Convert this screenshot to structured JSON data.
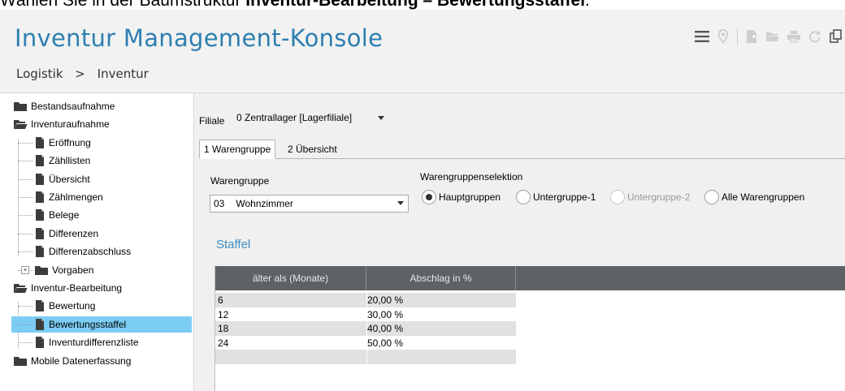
{
  "caption": {
    "prefix": "Wählen Sie in der Baumstruktur ",
    "bold": "Inventur-Bearbeitung – Bewertungsstaffel",
    "suffix": "."
  },
  "app": {
    "title": "Inventur Management-Konsole",
    "breadcrumb": {
      "first": "Logistik",
      "separator": ">",
      "second": "Inventur"
    }
  },
  "toolbar": {
    "icons": [
      "list-settings-icon",
      "pin-icon",
      "new-document-icon",
      "open-folder-icon",
      "print-icon",
      "refresh-icon",
      "copy-icon"
    ]
  },
  "sidebar": {
    "items": [
      {
        "label": "Bestandsaufnahme",
        "icon": "folder-closed-icon"
      },
      {
        "label": "Inventuraufnahme",
        "icon": "folder-open-icon"
      },
      {
        "label": "Eröffnung",
        "icon": "document-icon"
      },
      {
        "label": "Zähllisten",
        "icon": "document-icon"
      },
      {
        "label": "Übersicht",
        "icon": "document-icon"
      },
      {
        "label": "Zählmengen",
        "icon": "document-icon"
      },
      {
        "label": "Belege",
        "icon": "document-icon"
      },
      {
        "label": "Differenzen",
        "icon": "document-icon"
      },
      {
        "label": "Differenzabschluss",
        "icon": "document-icon"
      },
      {
        "label": "Vorgaben",
        "icon": "folder-closed-icon"
      },
      {
        "label": "Inventur-Bearbeitung",
        "icon": "folder-open-icon"
      },
      {
        "label": "Bewertung",
        "icon": "document-icon"
      },
      {
        "label": "Bewertungsstaffel",
        "icon": "document-icon",
        "selected": true
      },
      {
        "label": "Inventurdifferenzliste",
        "icon": "document-icon"
      },
      {
        "label": "Mobile Datenerfassung",
        "icon": "folder-closed-icon"
      }
    ],
    "expander_symbol": "+"
  },
  "filter": {
    "filiale_label": "Filiale",
    "filiale_value": "0 Zentrallager [Lagerfiliale]"
  },
  "tabs": [
    {
      "label": "1 Warengruppe",
      "active": true
    },
    {
      "label": "2 Übersicht",
      "active": false
    }
  ],
  "warengruppe": {
    "label": "Warengruppe",
    "code": "03",
    "name": "Wohnzimmer"
  },
  "selektion": {
    "label": "Warengruppenselektion",
    "options": [
      {
        "label": "Hauptgruppen",
        "selected": true,
        "disabled": false
      },
      {
        "label": "Untergruppe-1",
        "selected": false,
        "disabled": false
      },
      {
        "label": "Untergruppe-2",
        "selected": false,
        "disabled": true
      },
      {
        "label": "Alle Warengruppen",
        "selected": false,
        "disabled": false
      }
    ]
  },
  "staffel": {
    "title": "Staffel",
    "columns": [
      "älter als (Monate)",
      "Abschlag in %"
    ],
    "rows": [
      [
        "6",
        "20,00 %"
      ],
      [
        "12",
        "30,00 %"
      ],
      [
        "18",
        "40,00 %"
      ],
      [
        "24",
        "50,00 %"
      ],
      [
        "",
        ""
      ]
    ]
  },
  "colors": {
    "accent": "#2e7fb0",
    "selection": "#7ccdf4",
    "grid_header": "#5d6264"
  }
}
